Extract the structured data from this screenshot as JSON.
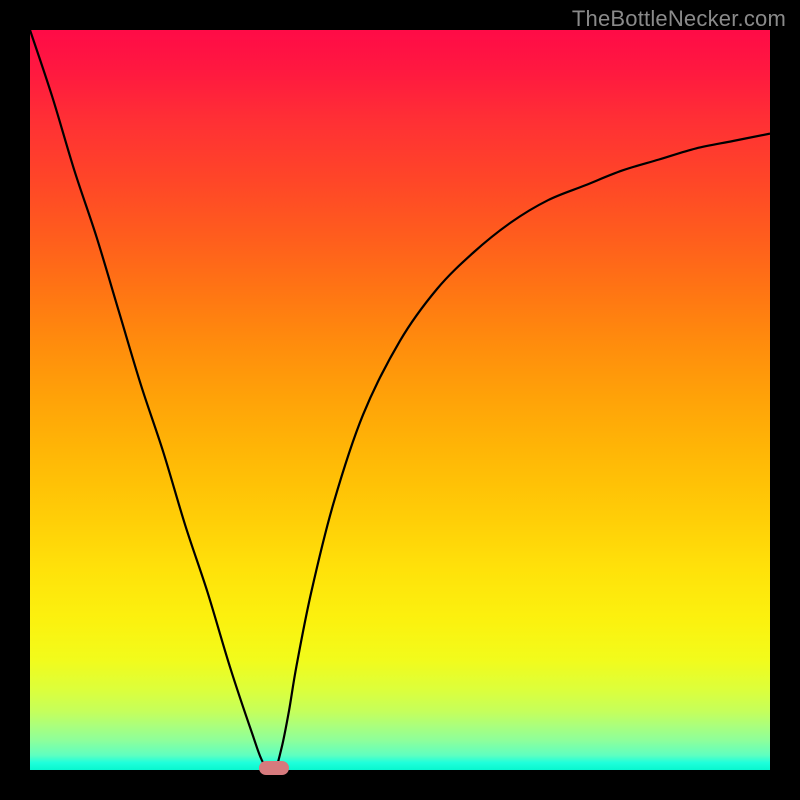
{
  "watermark": {
    "text": "TheBottleNecker.com"
  },
  "colors": {
    "frame": "#000000",
    "curve": "#000000",
    "marker": "#d77a7d",
    "watermark_text": "#8a8a8a"
  },
  "chart_data": {
    "type": "line",
    "title": "",
    "xlabel": "",
    "ylabel": "",
    "xlim": [
      0,
      100
    ],
    "ylim": [
      0,
      100
    ],
    "x": [
      0,
      3,
      6,
      9,
      12,
      15,
      18,
      21,
      24,
      27,
      30,
      31.5,
      33,
      34,
      35,
      36,
      38,
      41,
      45,
      50,
      55,
      60,
      65,
      70,
      75,
      80,
      85,
      90,
      95,
      100
    ],
    "values": [
      100,
      91,
      81,
      72,
      62,
      52,
      43,
      33,
      24,
      14,
      5,
      1,
      0,
      3,
      8,
      14,
      24,
      36,
      48,
      58,
      65,
      70,
      74,
      77,
      79,
      81,
      82.5,
      84,
      85,
      86
    ],
    "minimum_x": 33,
    "marker": {
      "x": 33,
      "y": 0,
      "w": 4,
      "h": 2
    },
    "background_gradient": {
      "direction": "vertical",
      "stops": [
        {
          "pos": 0,
          "color": "#ff0b47"
        },
        {
          "pos": 50,
          "color": "#ffa308"
        },
        {
          "pos": 80,
          "color": "#fbf20f"
        },
        {
          "pos": 100,
          "color": "#08f7cf"
        }
      ]
    }
  }
}
